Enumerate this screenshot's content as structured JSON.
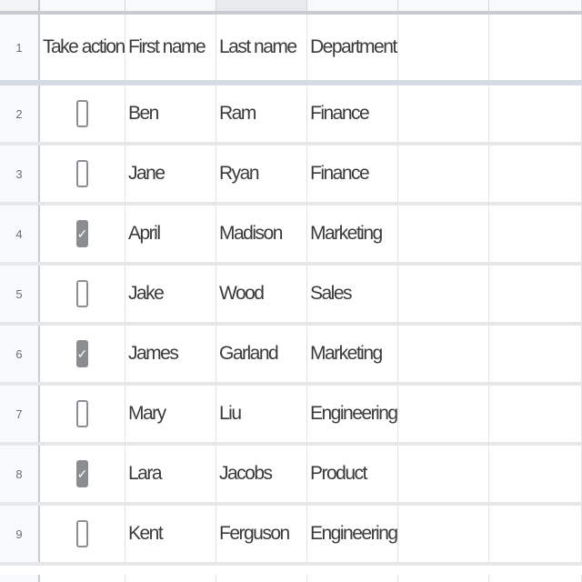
{
  "header_row": {
    "row_number": "1",
    "cells": [
      "Take action?",
      "First name",
      "Last name",
      "Department"
    ]
  },
  "rows": [
    {
      "row_number": "2",
      "checked": false,
      "first": "Ben",
      "last": "Ram",
      "dept": "Finance"
    },
    {
      "row_number": "3",
      "checked": false,
      "first": "Jane",
      "last": "Ryan",
      "dept": "Finance"
    },
    {
      "row_number": "4",
      "checked": true,
      "first": "April",
      "last": "Madison",
      "dept": "Marketing"
    },
    {
      "row_number": "5",
      "checked": false,
      "first": "Jake",
      "last": "Wood",
      "dept": "Sales"
    },
    {
      "row_number": "6",
      "checked": true,
      "first": "James",
      "last": "Garland",
      "dept": "Marketing"
    },
    {
      "row_number": "7",
      "checked": false,
      "first": "Mary",
      "last": "Liu",
      "dept": "Engineering"
    },
    {
      "row_number": "8",
      "checked": true,
      "first": "Lara",
      "last": "Jacobs",
      "dept": "Product"
    },
    {
      "row_number": "9",
      "checked": false,
      "first": "Kent",
      "last": "Ferguson",
      "dept": "Engineering"
    }
  ],
  "icons": {
    "checkbox_tick": "check-icon"
  },
  "colors": {
    "checkbox_checked": "#8a8d91",
    "frozen_bar": "#d5dbe3"
  }
}
